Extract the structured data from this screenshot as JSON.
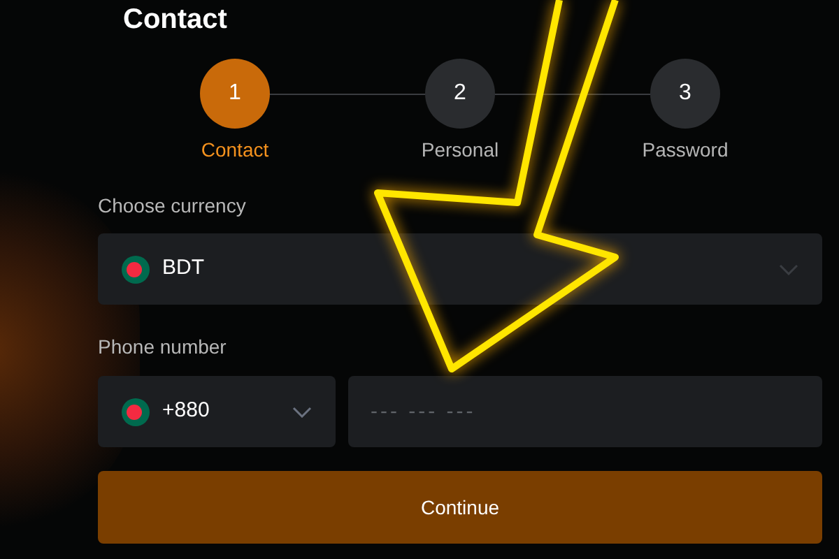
{
  "title": "Contact",
  "steps": [
    {
      "number": "1",
      "label": "Contact",
      "selected": true
    },
    {
      "number": "2",
      "label": "Personal",
      "selected": false
    },
    {
      "number": "3",
      "label": "Password",
      "selected": false
    }
  ],
  "currency": {
    "label": "Choose currency",
    "value": "BDT"
  },
  "phone": {
    "label": "Phone number",
    "code": "+880",
    "placeholder": "--- --- ---"
  },
  "button": "Continue"
}
